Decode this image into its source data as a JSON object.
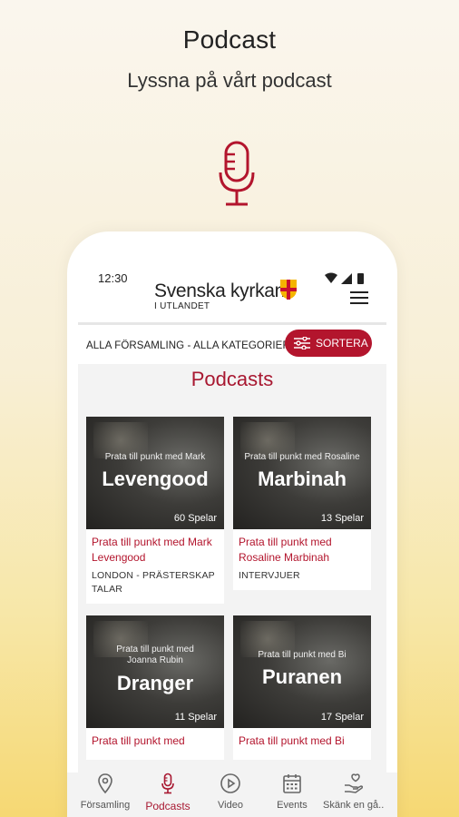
{
  "hero": {
    "title": "Podcast",
    "subtitle": "Lyssna på vårt podcast",
    "icon": "microphone-icon",
    "accent_color": "#b3152d"
  },
  "status_bar": {
    "time": "12:30"
  },
  "app_bar": {
    "brand_name": "Svenska kyrkan",
    "brand_sub": "I UTLANDET",
    "menu_icon": "hamburger-menu-icon"
  },
  "filter_bar": {
    "filter_text": "ALLA FÖRSAMLING - ALLA KATEGORIER",
    "sort_label": "SORTERA",
    "sort_color": "#b3152d"
  },
  "content": {
    "title": "Podcasts",
    "cards": [
      {
        "thumb_small": "Prata till punkt med Mark",
        "thumb_big": "Levengood",
        "plays": "60 Spelar",
        "title": "Prata till punkt med Mark Levengood",
        "category": "LONDON - PRÄSTERSKAP TALAR"
      },
      {
        "thumb_small": "Prata till punkt med Rosaline",
        "thumb_big": "Marbinah",
        "plays": "13 Spelar",
        "title": "Prata till punkt med Rosaline Marbinah",
        "category": "INTERVJUER"
      },
      {
        "thumb_small": "Prata till punkt med Joanna Rubin",
        "thumb_big": "Dranger",
        "plays": "11 Spelar",
        "title": "Prata till punkt med",
        "category": ""
      },
      {
        "thumb_small": "Prata till punkt med Bi",
        "thumb_big": "Puranen",
        "plays": "17 Spelar",
        "title": "Prata till punkt med Bi",
        "category": ""
      }
    ]
  },
  "bottom_nav": {
    "items": [
      {
        "label": "Församling",
        "icon": "location-pin-icon",
        "active": false
      },
      {
        "label": "Podcasts",
        "icon": "microphone-icon",
        "active": true
      },
      {
        "label": "Video",
        "icon": "play-circle-icon",
        "active": false
      },
      {
        "label": "Events",
        "icon": "calendar-icon",
        "active": false
      },
      {
        "label": "Skänk en gå...",
        "icon": "hand-heart-icon",
        "active": false
      }
    ]
  }
}
